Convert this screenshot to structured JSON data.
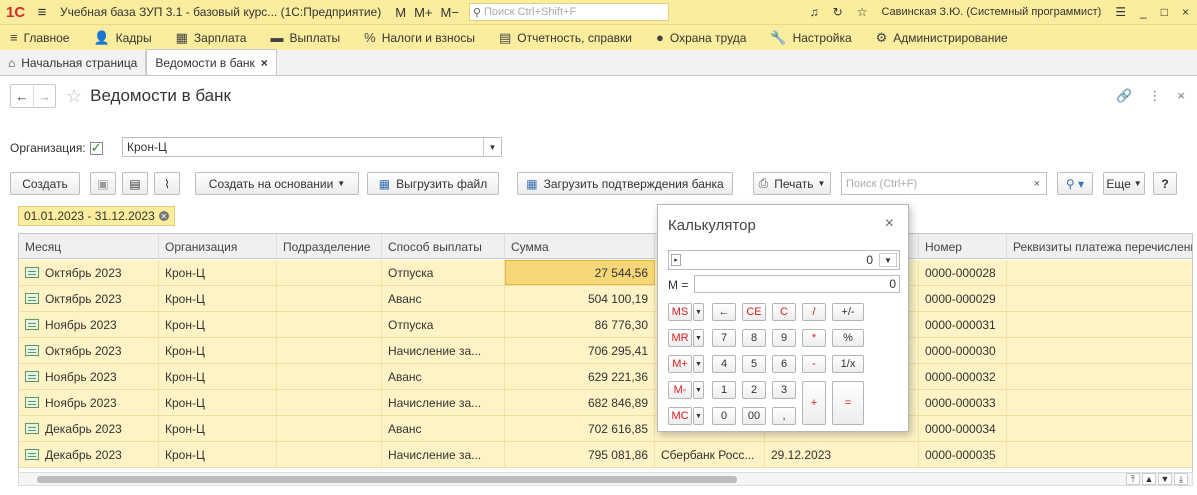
{
  "titlebar": {
    "logo": "1С",
    "title": "Учебная база ЗУП 3.1 - базовый курс...  (1С:Предприятие)",
    "m_buttons": [
      "M",
      "M+",
      "M−"
    ],
    "search_placeholder": "Поиск Ctrl+Shift+F",
    "user": "Савинская З.Ю. (Системный программист)"
  },
  "menu": {
    "items": [
      {
        "label": "Главное",
        "icon": "menu-icon"
      },
      {
        "label": "Кадры",
        "icon": "people-icon"
      },
      {
        "label": "Зарплата",
        "icon": "calculator-icon"
      },
      {
        "label": "Выплаты",
        "icon": "wallet-icon"
      },
      {
        "label": "Налоги и взносы",
        "icon": "percent-icon"
      },
      {
        "label": "Отчетность, справки",
        "icon": "report-icon"
      },
      {
        "label": "Охрана труда",
        "icon": "helmet-icon"
      },
      {
        "label": "Настройка",
        "icon": "wrench-icon"
      },
      {
        "label": "Администрирование",
        "icon": "gear-icon"
      }
    ]
  },
  "tabs": [
    {
      "label": "Начальная страница",
      "icon": "home-icon"
    },
    {
      "label": "Ведомости в банк",
      "active": true
    }
  ],
  "form": {
    "title": "Ведомости в банк",
    "org_label": "Организация:",
    "org_value": "Крон-Ц"
  },
  "toolbar": {
    "create": "Создать",
    "create_based": "Создать на основании",
    "export_file": "Выгрузить файл",
    "import_confirm": "Загрузить подтверждения банка",
    "print": "Печать",
    "search_placeholder": "Поиск (Ctrl+F)",
    "more": "Еще",
    "help": "?"
  },
  "period": "01.01.2023 - 31.12.2023",
  "table": {
    "columns": [
      "Месяц",
      "Организация",
      "Подразделение",
      "Способ выплаты",
      "Сумма",
      "",
      "",
      "Номер",
      "Реквизиты платежа перечисления"
    ],
    "rows": [
      {
        "month": "Октябрь 2023",
        "org": "Крон-Ц",
        "dept": "",
        "method": "Отпуска",
        "sum": "27 544,56",
        "bank": "",
        "date": "",
        "number": "0000-000028"
      },
      {
        "month": "Октябрь 2023",
        "org": "Крон-Ц",
        "dept": "",
        "method": "Аванс",
        "sum": "504 100,19",
        "bank": "",
        "date": "",
        "number": "0000-000029"
      },
      {
        "month": "Ноябрь 2023",
        "org": "Крон-Ц",
        "dept": "",
        "method": "Отпуска",
        "sum": "86 776,30",
        "bank": "",
        "date": "",
        "number": "0000-000031"
      },
      {
        "month": "Октябрь 2023",
        "org": "Крон-Ц",
        "dept": "",
        "method": "Начисление за...",
        "sum": "706 295,41",
        "bank": "",
        "date": "",
        "number": "0000-000030"
      },
      {
        "month": "Ноябрь 2023",
        "org": "Крон-Ц",
        "dept": "",
        "method": "Аванс",
        "sum": "629 221,36",
        "bank": "",
        "date": "",
        "number": "0000-000032"
      },
      {
        "month": "Ноябрь 2023",
        "org": "Крон-Ц",
        "dept": "",
        "method": "Начисление за...",
        "sum": "682 846,89",
        "bank": "",
        "date": "",
        "number": "0000-000033"
      },
      {
        "month": "Декабрь 2023",
        "org": "Крон-Ц",
        "dept": "",
        "method": "Аванс",
        "sum": "702 616,85",
        "bank": "",
        "date": "",
        "number": "0000-000034"
      },
      {
        "month": "Декабрь 2023",
        "org": "Крон-Ц",
        "dept": "",
        "method": "Начисление за...",
        "sum": "795 081,86",
        "bank": "Сбербанк Росс...",
        "date": "29.12.2023",
        "number": "0000-000035"
      }
    ]
  },
  "calculator": {
    "title": "Калькулятор",
    "display": "0",
    "memory_label": "M =",
    "memory_value": "0",
    "keys": {
      "ms": "MS",
      "mr": "MR",
      "mplus": "M+",
      "mminus": "M-",
      "mc": "MC",
      "back": "←",
      "ce": "CE",
      "c": "C",
      "div": "/",
      "sign": "+/-",
      "k7": "7",
      "k8": "8",
      "k9": "9",
      "mul": "*",
      "pct": "%",
      "k4": "4",
      "k5": "5",
      "k6": "6",
      "sub": "-",
      "inv": "1/x",
      "k1": "1",
      "k2": "2",
      "k3": "3",
      "add": "+",
      "eq": "=",
      "k0": "0",
      "k00": "00",
      "dot": ","
    }
  }
}
